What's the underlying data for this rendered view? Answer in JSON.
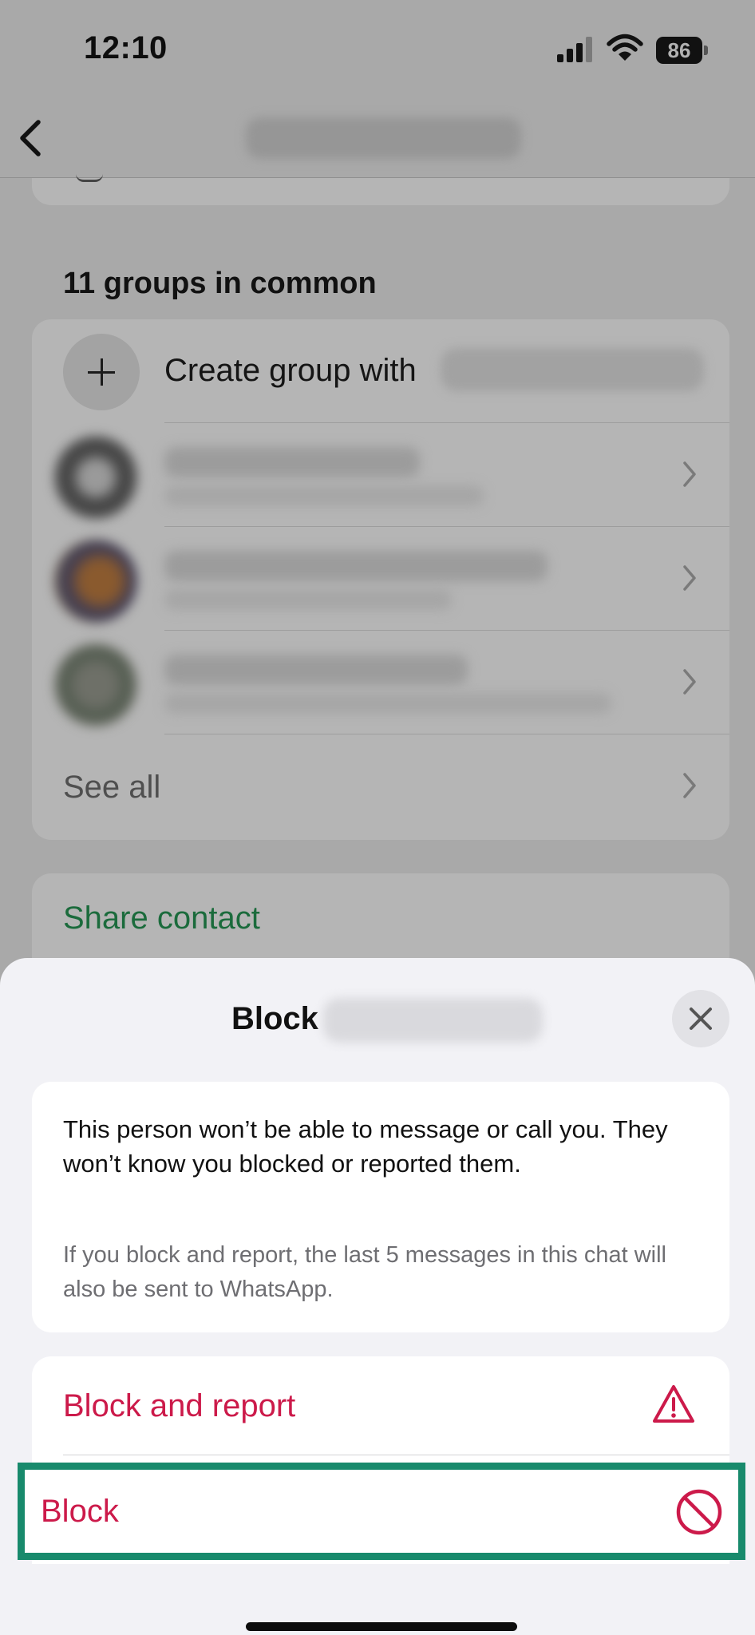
{
  "status_bar": {
    "time": "12:10",
    "battery": "86",
    "icons": [
      "cellular-signal-icon",
      "wifi-icon",
      "battery-icon"
    ]
  },
  "nav": {
    "back_icon": "chevron-left-icon"
  },
  "groups": {
    "title": "11 groups in common",
    "create_label": "Create group with",
    "see_all": "See all"
  },
  "share": {
    "label": "Share contact"
  },
  "sheet": {
    "title": "Block",
    "info_primary": "This person won’t be able to message or call you. They won’t know you blocked or reported them.",
    "info_secondary": "If you block and report, the last 5 messages in this chat will also be sent to WhatsApp.",
    "actions": {
      "block_and_report": "Block and report",
      "block": "Block"
    }
  },
  "colors": {
    "destructive": "#cc1a4a",
    "share_green": "#1b6b3c",
    "highlight_border": "#188a6c",
    "sheet_bg": "#f2f2f6"
  }
}
